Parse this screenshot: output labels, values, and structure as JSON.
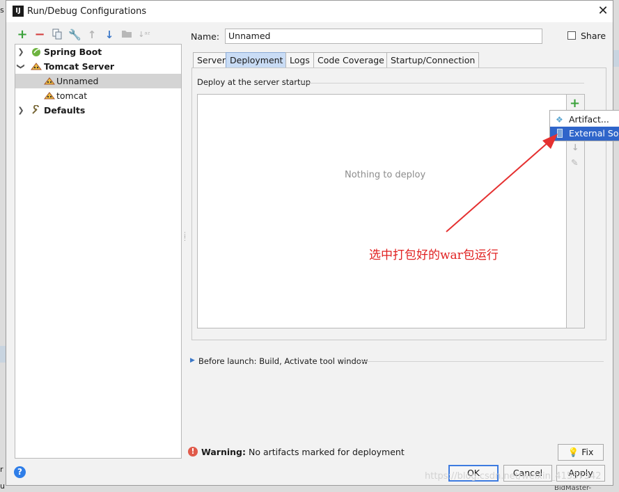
{
  "window": {
    "title": "Run/Debug Configurations",
    "app_icon_letter": "IJ"
  },
  "background_fragments": {
    "left_top": "s",
    "left_mid": "r",
    "left_bottom": "u",
    "right_bottom": "BidMaster-"
  },
  "toolbar": {
    "icons": [
      "add-icon",
      "remove-icon",
      "copy-icon",
      "wrench-icon",
      "move-up-icon",
      "move-down-icon",
      "folder-icon",
      "sort-icon"
    ]
  },
  "tree": {
    "items": [
      {
        "label": "Spring Boot",
        "bold": true,
        "expanded": false,
        "level": 0
      },
      {
        "label": "Tomcat Server",
        "bold": true,
        "expanded": true,
        "level": 0
      },
      {
        "label": "Unnamed",
        "bold": false,
        "selected": true,
        "level": 1
      },
      {
        "label": "tomcat",
        "bold": false,
        "level": 1
      },
      {
        "label": "Defaults",
        "bold": true,
        "expanded": false,
        "level": 0
      }
    ]
  },
  "name_field": {
    "label": "Name:",
    "value": "Unnamed"
  },
  "share": {
    "label": "Share",
    "checked": false
  },
  "tabs": [
    {
      "label": "Server",
      "active": false
    },
    {
      "label": "Deployment",
      "active": true
    },
    {
      "label": "Logs",
      "active": false
    },
    {
      "label": "Code Coverage",
      "active": false
    },
    {
      "label": "Startup/Connection",
      "active": false
    }
  ],
  "deployment": {
    "section_title": "Deploy at the server startup",
    "empty_text": "Nothing to deploy",
    "side_buttons": [
      "add-icon",
      "move-down-icon",
      "edit-icon"
    ]
  },
  "popup_menu": {
    "items": [
      {
        "label": "Artifact...",
        "highlighted": false
      },
      {
        "label": "External Source...",
        "highlighted": true
      }
    ]
  },
  "annotation": {
    "text": "选中打包好的war包运行",
    "color": "#e02020"
  },
  "before_launch": {
    "label": "Before launch: Build, Activate tool window"
  },
  "warning": {
    "bold": "Warning:",
    "text": "No artifacts marked for deployment"
  },
  "buttons": {
    "fix": "Fix",
    "ok": "OK",
    "cancel": "Cancel",
    "apply": "Apply"
  },
  "watermark": "https://blog.csdn.net/weixin_41557542",
  "colors": {
    "accent": "#2f65ca",
    "add_green": "#3aa13a",
    "remove_red": "#d33c3c",
    "tab_active": "#c9dcf5"
  }
}
